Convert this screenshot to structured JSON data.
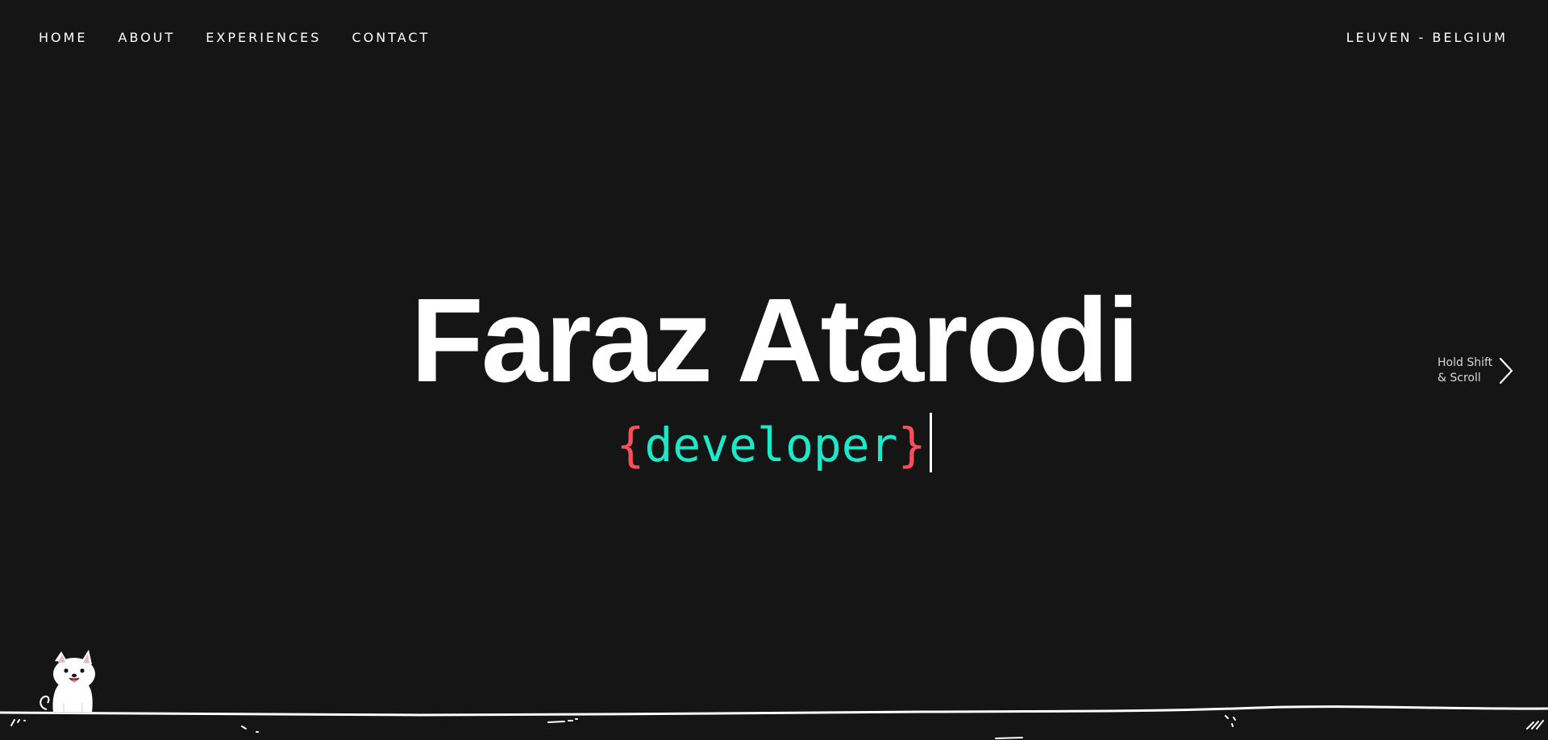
{
  "nav": {
    "items": [
      {
        "label": "HOME"
      },
      {
        "label": "ABOUT"
      },
      {
        "label": "EXPERIENCES"
      },
      {
        "label": "CONTACT"
      }
    ]
  },
  "location": "LEUVEN - BELGIUM",
  "hero": {
    "name": "Faraz Atarodi",
    "brace_open": "{",
    "role": "developer",
    "brace_close": "}"
  },
  "scroll_hint": {
    "line1": "Hold Shift",
    "line2": "& Scroll"
  },
  "icons": {
    "scroll_hint": "chevron-right-icon",
    "mascot": "dog-mascot"
  },
  "colors": {
    "background": "#151515",
    "text": "#ffffff",
    "brace": "#f6515b",
    "role": "#1ee8c8",
    "hint_text": "#d8d8d8"
  }
}
